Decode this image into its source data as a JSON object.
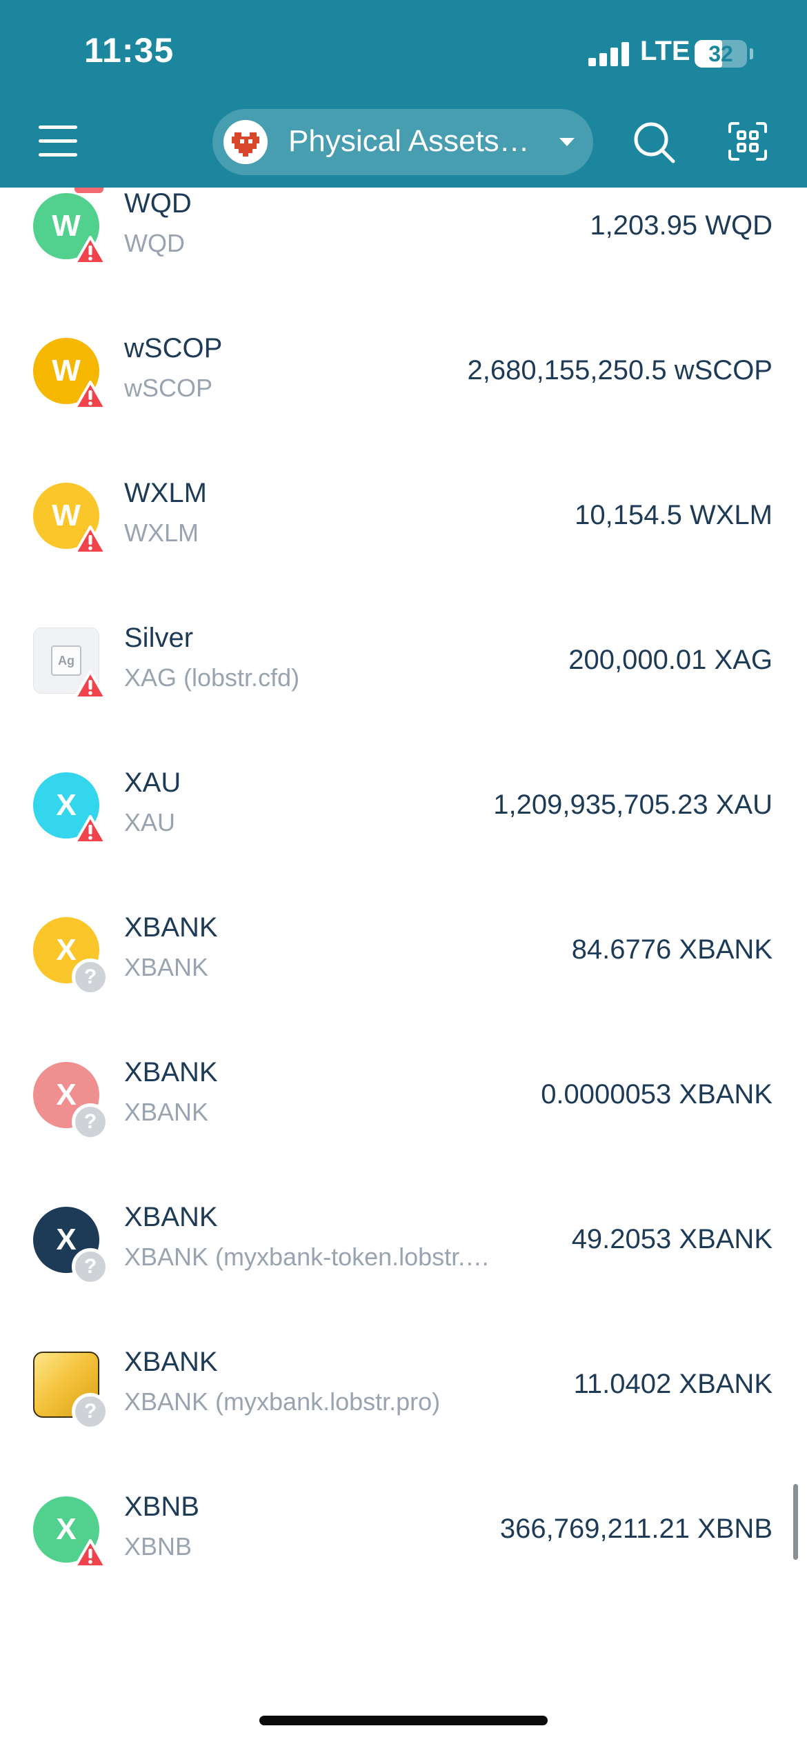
{
  "status_bar": {
    "time": "11:35",
    "network": "LTE",
    "battery": "32"
  },
  "header": {
    "menu_icon": "hamburger-icon",
    "account_label": "Physical Assets…",
    "account_icon": "pixel-heart-logo",
    "dropdown_icon": "caret-down-icon",
    "search_icon": "search-icon",
    "scan_icon": "qr-scan-icon"
  },
  "colors": {
    "header": "#1b869e",
    "text_primary": "#1d3a57",
    "text_secondary": "#9aa3b0",
    "warning": "#f0434b",
    "unknown": "#cfd3d8"
  },
  "assets": [
    {
      "name": "WQD",
      "code": "WQD",
      "amount": "1,203.95 WQD",
      "letter": "W",
      "color": "#52d18e",
      "badge": "warning",
      "icon_type": "letter"
    },
    {
      "name": "wSCOP",
      "code": "wSCOP",
      "amount": "2,680,155,250.5 wSCOP",
      "letter": "W",
      "color": "#f5b700",
      "badge": "warning",
      "icon_type": "letter"
    },
    {
      "name": "WXLM",
      "code": "WXLM",
      "amount": "10,154.5 WXLM",
      "letter": "W",
      "color": "#fbc62a",
      "badge": "warning",
      "icon_type": "letter"
    },
    {
      "name": "Silver",
      "code": "XAG (lobstr.cfd)",
      "amount": "200,000.01 XAG",
      "letter": "Ag",
      "color": "#f1f2f4",
      "badge": "warning",
      "icon_type": "silver"
    },
    {
      "name": "XAU",
      "code": "XAU",
      "amount": "1,209,935,705.23 XAU",
      "letter": "X",
      "color": "#33d6ec",
      "badge": "warning",
      "icon_type": "letter"
    },
    {
      "name": "XBANK",
      "code": "XBANK",
      "amount": "84.6776 XBANK",
      "letter": "X",
      "color": "#fbc62a",
      "badge": "unknown",
      "icon_type": "letter"
    },
    {
      "name": "XBANK",
      "code": "XBANK",
      "amount": "0.0000053 XBANK",
      "letter": "X",
      "color": "#ef8f90",
      "badge": "unknown",
      "icon_type": "letter"
    },
    {
      "name": "XBANK",
      "code": "XBANK (myxbank-token.lobstr.…",
      "amount": "49.2053 XBANK",
      "letter": "X",
      "color": "#1d3a57",
      "badge": "unknown",
      "icon_type": "letter"
    },
    {
      "name": "XBANK",
      "code": "XBANK (myxbank.lobstr.pro)",
      "amount": "11.0402 XBANK",
      "letter": "",
      "color": "#f5c43e",
      "badge": "unknown",
      "icon_type": "gold"
    },
    {
      "name": "XBNB",
      "code": "XBNB",
      "amount": "366,769,211.21 XBNB",
      "letter": "X",
      "color": "#52d18e",
      "badge": "warning",
      "icon_type": "letter"
    }
  ]
}
